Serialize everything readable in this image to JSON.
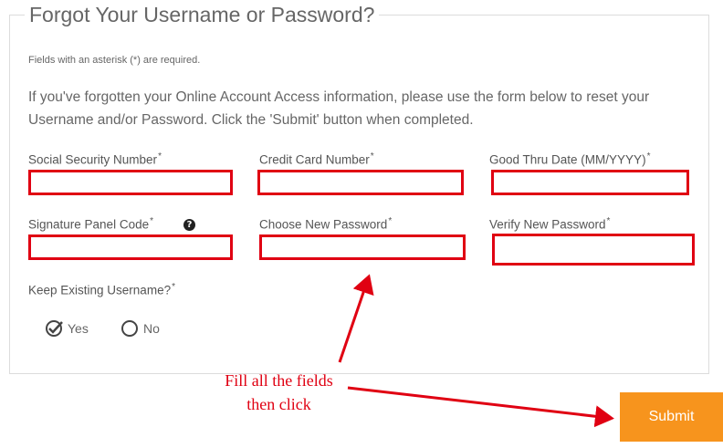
{
  "form": {
    "title": "Forgot Your Username or Password?",
    "required_note": "Fields with an asterisk (*) are required.",
    "intro": "If you've forgotten your Online Account Access information, please use the form below to reset your Username and/or Password. Click the 'Submit' button when completed.",
    "fields": {
      "ssn": {
        "label": "Social Security Number",
        "value": ""
      },
      "credit_card": {
        "label": "Credit Card Number",
        "value": ""
      },
      "good_thru": {
        "label": "Good Thru Date (MM/YYYY)",
        "value": ""
      },
      "signature_code": {
        "label": "Signature Panel Code",
        "value": ""
      },
      "new_password": {
        "label": "Choose New Password",
        "value": ""
      },
      "verify_password": {
        "label": "Verify New Password",
        "value": ""
      }
    },
    "asterisk": "*",
    "help_icon_glyph": "?",
    "keep_username": {
      "label": "Keep Existing Username?",
      "yes": "Yes",
      "no": "No",
      "selected": "Yes"
    },
    "submit_label": "Submit"
  },
  "annotation": {
    "line1": "Fill all the fields",
    "line2": "then click"
  },
  "colors": {
    "highlight": "#e00012",
    "submit_bg": "#f7941d"
  }
}
